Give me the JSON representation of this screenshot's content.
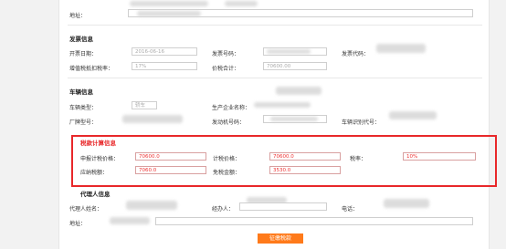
{
  "top": {
    "address_label": "地址："
  },
  "invoice": {
    "title": "发票信息",
    "issue_date_label": "开票日期：",
    "issue_date_value": "2016-06-16",
    "invoice_no_label": "发票号码：",
    "invoice_code_label": "发票代码：",
    "vat_rate_label": "增值税抵扣税率：",
    "vat_rate_value": "17%",
    "price_total_label": "价税合计：",
    "price_total_value": "70600.00"
  },
  "vehicle": {
    "title": "车辆信息",
    "type_label": "车辆类型：",
    "type_value": "轿车",
    "manufacturer_label": "生产企业名称：",
    "model_label": "厂牌型号：",
    "engine_no_label": "发动机号码：",
    "vin_label": "车辆识别代号："
  },
  "tax": {
    "title": "税款计算信息",
    "declared_price_label": "申报计税价格：",
    "declared_price_value": "70600.0",
    "taxable_price_label": "计税价格：",
    "taxable_price_value": "70600.0",
    "rate_label": "税率：",
    "rate_value": "10%",
    "tax_due_label": "应纳税额：",
    "tax_due_value": "7060.0",
    "exempt_label": "免税金额：",
    "exempt_value": "3530.0"
  },
  "agent": {
    "title": "代理人信息",
    "name_label": "代理人姓名：",
    "handler_label": "经办人：",
    "phone_label": "电话：",
    "address_label": "地址："
  },
  "actions": {
    "submit_label": "征缴税款"
  },
  "colors": {
    "highlight": "#e8282a",
    "button": "#ff7a1a",
    "value_red": "#e33333"
  }
}
